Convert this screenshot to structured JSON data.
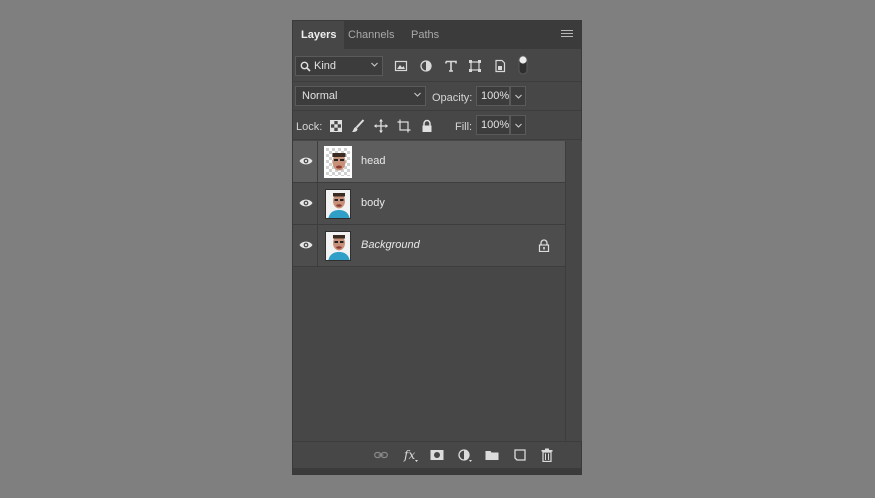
{
  "tabs": [
    {
      "label": "Layers",
      "active": true
    },
    {
      "label": "Channels",
      "active": false
    },
    {
      "label": "Paths",
      "active": false
    }
  ],
  "filter": {
    "kind_label": "Kind",
    "icons": [
      "image-filter-icon",
      "adjustment-filter-icon",
      "type-filter-icon",
      "shape-filter-icon",
      "smart-object-filter-icon",
      "filter-toggle-icon"
    ]
  },
  "blend": {
    "mode": "Normal",
    "opacity_label": "Opacity:",
    "opacity_value": "100%"
  },
  "lock": {
    "label": "Lock:",
    "icons": [
      "lock-transparent-icon",
      "lock-image-icon",
      "lock-position-icon",
      "lock-artboard-icon",
      "lock-all-icon"
    ],
    "fill_label": "Fill:",
    "fill_value": "100%"
  },
  "layers": [
    {
      "name": "head",
      "selected": true,
      "italic": false,
      "locked": false,
      "visible": true
    },
    {
      "name": "body",
      "selected": false,
      "italic": false,
      "locked": false,
      "visible": true
    },
    {
      "name": "Background",
      "selected": false,
      "italic": true,
      "locked": true,
      "visible": true
    }
  ],
  "bottom_icons": [
    "link-icon",
    "fx-icon",
    "mask-icon",
    "adjustment-layer-icon",
    "group-folder-icon",
    "new-layer-icon",
    "trash-icon"
  ],
  "colors": {
    "page_background": "#7f7f7f",
    "panel_background": "#474747",
    "selected_layer": "#5e5e5e"
  }
}
